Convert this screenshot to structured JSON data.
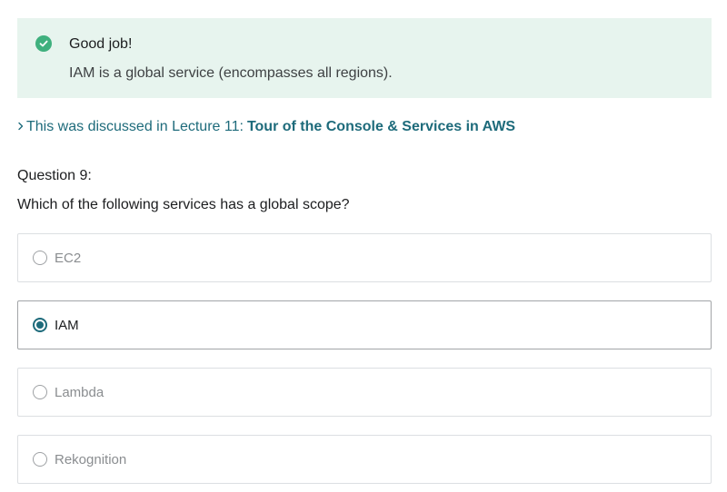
{
  "feedback": {
    "title": "Good job!",
    "message": "IAM is a global service (encompasses all regions).",
    "status": "correct",
    "color": "#3fb07e",
    "background": "#e7f4ee"
  },
  "lecture_link": {
    "prefix": "This was discussed in Lecture 11:",
    "lecture_title": "Tour of the Console & Services in AWS",
    "color": "#1e6b7b"
  },
  "question": {
    "label": "Question 9:",
    "text": "Which of the following services has a global scope?",
    "options": [
      {
        "label": "EC2",
        "selected": false
      },
      {
        "label": "IAM",
        "selected": true
      },
      {
        "label": "Lambda",
        "selected": false
      },
      {
        "label": "Rekognition",
        "selected": false
      }
    ]
  }
}
